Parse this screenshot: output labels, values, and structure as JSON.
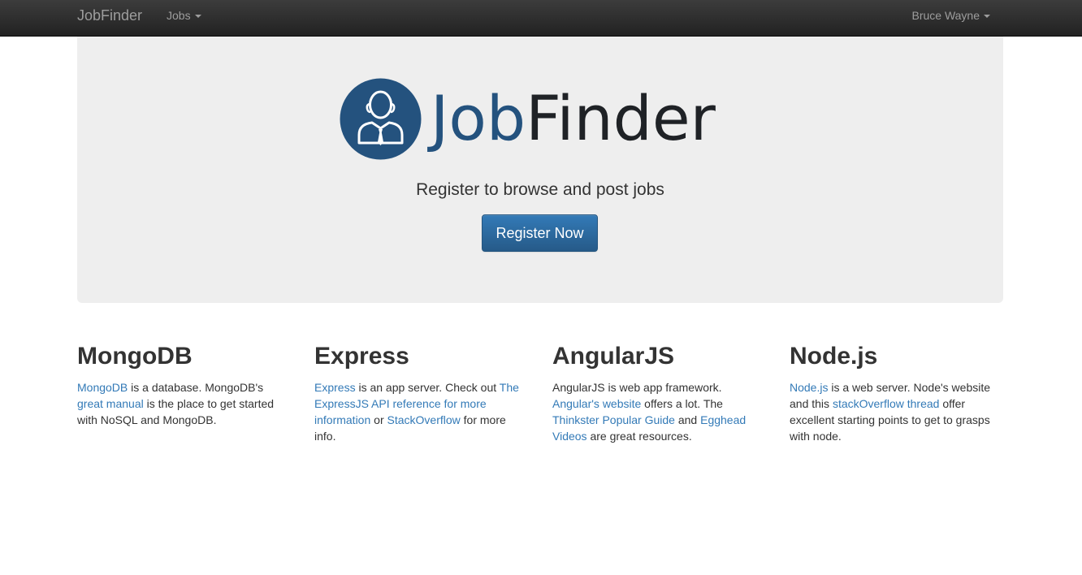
{
  "navbar": {
    "brand": "JobFinder",
    "jobs_menu": "Jobs",
    "user_menu": "Bruce Wayne"
  },
  "jumbotron": {
    "logo_job": "Job",
    "logo_finder": "Finder",
    "tagline": "Register to browse and post jobs",
    "register_button": "Register Now"
  },
  "columns": [
    {
      "title": "MongoDB",
      "parts": [
        "MongoDB",
        " is a database. MongoDB's ",
        "great manual",
        " is the place to get started with NoSQL and MongoDB."
      ]
    },
    {
      "title": "Express",
      "parts": [
        "Express",
        " is an app server. Check out ",
        "The ExpressJS API reference for more information",
        " or ",
        "StackOverflow",
        " for more info."
      ]
    },
    {
      "title": "AngularJS",
      "parts": [
        "AngularJS is web app framework. ",
        "Angular's website",
        " offers a lot. The ",
        "Thinkster Popular Guide",
        " and ",
        "Egghead Videos",
        " are great resources."
      ]
    },
    {
      "title": "Node.js",
      "parts": [
        "Node.js",
        " is a web server. Node's website and this ",
        "stackOverflow thread",
        " offer excellent starting points to get to grasps with node."
      ]
    }
  ],
  "colors": {
    "navbar_bg": "#222222",
    "jumbotron_bg": "#eeeeee",
    "link": "#337ab7",
    "primary_button": "#2e6da4",
    "logo_blue": "#24527e"
  },
  "icons": {
    "logo": "businessman-avatar-icon",
    "dropdown": "caret-down-icon"
  }
}
